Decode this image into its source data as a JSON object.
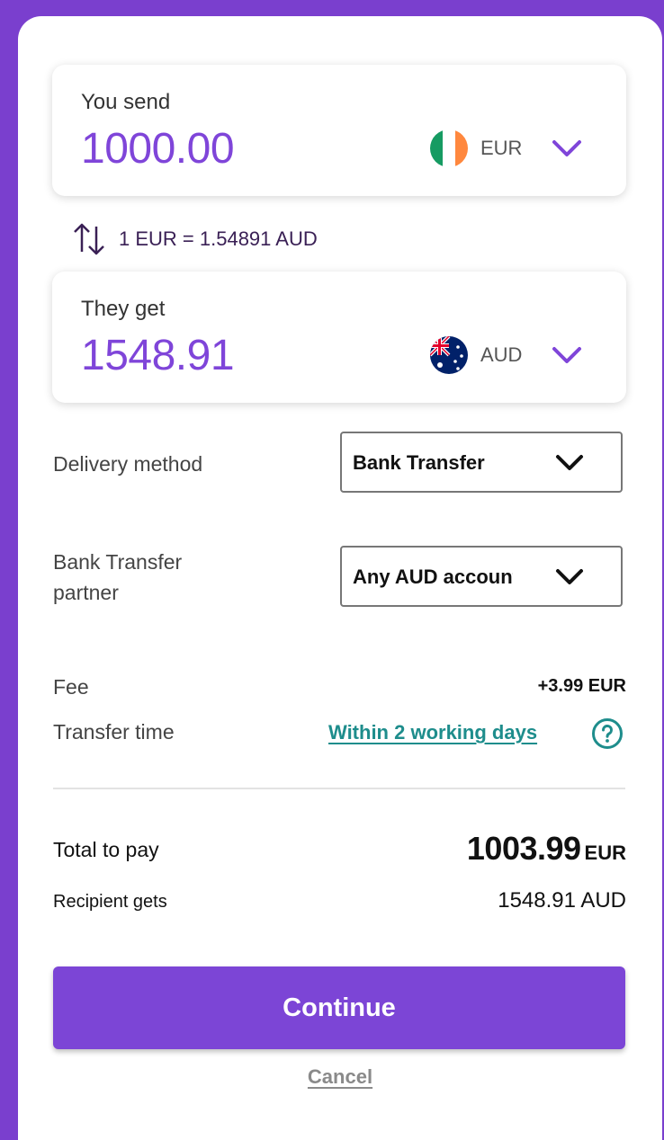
{
  "send": {
    "label": "You send",
    "amount": "1000.00",
    "currency": "EUR",
    "flag": "ireland-flag-icon"
  },
  "rate": {
    "text": "1 EUR = 1.54891 AUD",
    "icon": "swap-arrows-icon"
  },
  "receive": {
    "label": "They get",
    "amount": "1548.91",
    "currency": "AUD",
    "flag": "australia-flag-icon"
  },
  "delivery": {
    "label": "Delivery method",
    "selected": "Bank Transfer"
  },
  "partner": {
    "label_line1": "Bank Transfer",
    "label_line2": "partner",
    "selected": "Any AUD account"
  },
  "fee": {
    "label": "Fee",
    "value": "+3.99 EUR"
  },
  "transfer_time": {
    "label": "Transfer time",
    "value": "Within 2 working days"
  },
  "totals": {
    "total_label": "Total to pay",
    "total_amount": "1003.99",
    "total_currency": "EUR",
    "recipient_label": "Recipient gets",
    "recipient_amount": "1548.91 AUD"
  },
  "actions": {
    "continue_label": "Continue",
    "cancel_label": "Cancel"
  },
  "colors": {
    "accent": "#7c45d6",
    "link": "#1e8d8c",
    "amount": "#7f45d9"
  }
}
